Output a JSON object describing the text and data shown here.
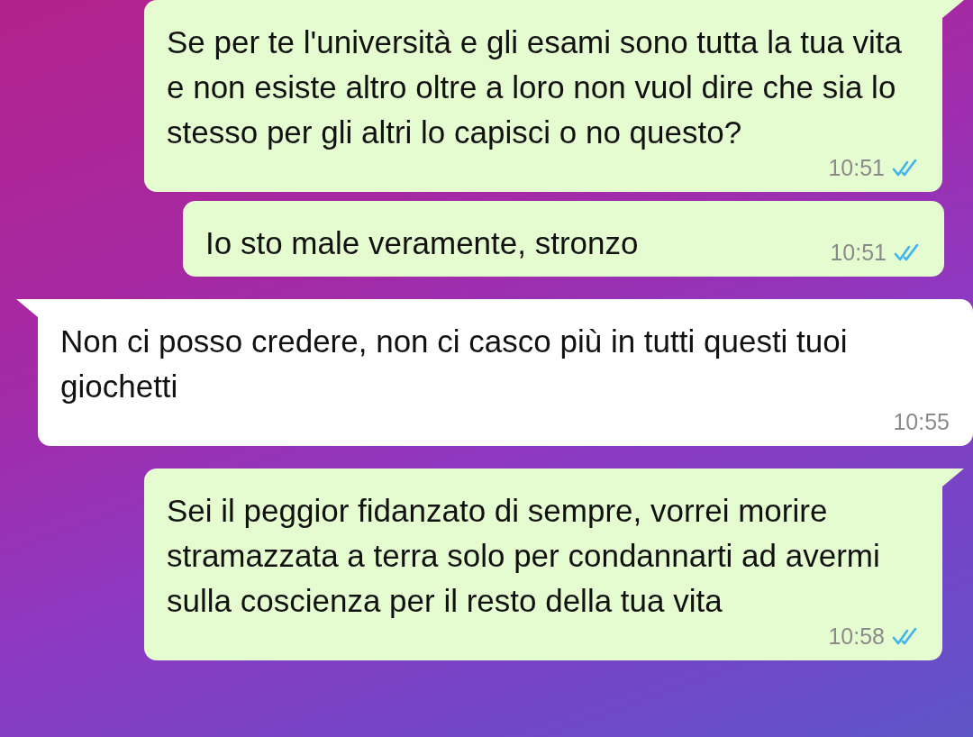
{
  "messages": [
    {
      "kind": "outgoing",
      "tail": true,
      "text": "Se per te l'università e gli esami sono tutta la tua vita e non esiste altro oltre a loro non vuol dire che sia lo stesso per gli altri lo capisci o no questo?",
      "time": "10:51",
      "read": true
    },
    {
      "kind": "outgoing",
      "tail": false,
      "text": "Io sto male veramente, stronzo",
      "time": "10:51",
      "read": true
    },
    {
      "kind": "incoming",
      "tail": true,
      "text": "Non ci posso credere, non ci casco più in tutti questi tuoi giochetti",
      "time": "10:55"
    },
    {
      "kind": "outgoing",
      "tail": true,
      "text": "Sei il peggior fidanzato di sempre, vorrei morire stramazzata a terra solo per condannarti ad avermi sulla coscienza per il resto della tua vita",
      "time": "10:58",
      "read": true
    }
  ]
}
